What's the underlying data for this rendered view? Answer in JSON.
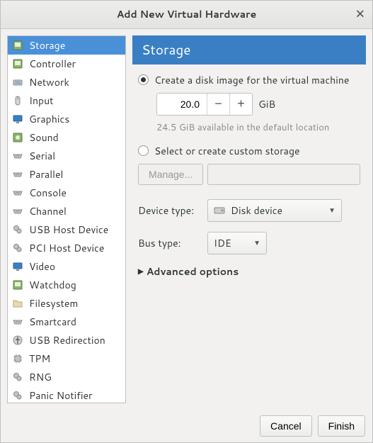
{
  "window": {
    "title": "Add New Virtual Hardware"
  },
  "sidebar": {
    "items": [
      {
        "id": "storage",
        "label": "Storage",
        "icon": "disk-icon"
      },
      {
        "id": "controller",
        "label": "Controller",
        "icon": "controller-icon"
      },
      {
        "id": "network",
        "label": "Network",
        "icon": "network-icon"
      },
      {
        "id": "input",
        "label": "Input",
        "icon": "mouse-icon"
      },
      {
        "id": "graphics",
        "label": "Graphics",
        "icon": "display-icon"
      },
      {
        "id": "sound",
        "label": "Sound",
        "icon": "sound-icon"
      },
      {
        "id": "serial",
        "label": "Serial",
        "icon": "serial-icon"
      },
      {
        "id": "parallel",
        "label": "Parallel",
        "icon": "serial-icon"
      },
      {
        "id": "console",
        "label": "Console",
        "icon": "serial-icon"
      },
      {
        "id": "channel",
        "label": "Channel",
        "icon": "serial-icon"
      },
      {
        "id": "usb-host-device",
        "label": "USB Host Device",
        "icon": "system-icon"
      },
      {
        "id": "pci-host-device",
        "label": "PCI Host Device",
        "icon": "system-icon"
      },
      {
        "id": "video",
        "label": "Video",
        "icon": "display-icon"
      },
      {
        "id": "watchdog",
        "label": "Watchdog",
        "icon": "controller-icon"
      },
      {
        "id": "filesystem",
        "label": "Filesystem",
        "icon": "folder-icon"
      },
      {
        "id": "smartcard",
        "label": "Smartcard",
        "icon": "serial-icon"
      },
      {
        "id": "usb-redirection",
        "label": "USB Redirection",
        "icon": "usb-icon"
      },
      {
        "id": "tpm",
        "label": "TPM",
        "icon": "chip-icon"
      },
      {
        "id": "rng",
        "label": "RNG",
        "icon": "system-icon"
      },
      {
        "id": "panic-notifier",
        "label": "Panic Notifier",
        "icon": "system-icon"
      }
    ],
    "selected": "storage"
  },
  "main": {
    "title": "Storage",
    "create_option": {
      "label": "Create a disk image for the virtual machine",
      "selected": true,
      "size_value": "20.0",
      "size_unit": "GiB",
      "available_hint": "24.5 GiB available in the default location"
    },
    "custom_option": {
      "label": "Select or create custom storage",
      "selected": false,
      "manage_label": "Manage...",
      "path_value": ""
    },
    "device_type": {
      "label": "Device type:",
      "value": "Disk device"
    },
    "bus_type": {
      "label": "Bus type:",
      "value": "IDE"
    },
    "advanced": {
      "label": "Advanced options",
      "expanded": false
    }
  },
  "footer": {
    "cancel": "Cancel",
    "finish": "Finish"
  }
}
